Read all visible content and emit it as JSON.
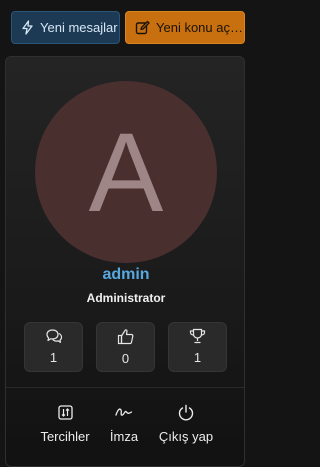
{
  "top_buttons": {
    "new_messages": {
      "label": "Yeni mesajlar",
      "icon": "lightning-icon"
    },
    "new_topic": {
      "label": "Yeni konu aç…",
      "icon": "edit-icon"
    }
  },
  "profile": {
    "avatar_letter": "A",
    "username": "admin",
    "role": "Administrator",
    "stats": [
      {
        "icon": "messages-icon",
        "value": "1"
      },
      {
        "icon": "thumbs-up-icon",
        "value": "0"
      },
      {
        "icon": "trophy-icon",
        "value": "1"
      }
    ],
    "actions": [
      {
        "icon": "preferences-icon",
        "label": "Tercihler"
      },
      {
        "icon": "signature-icon",
        "label": "İmza"
      },
      {
        "icon": "power-icon",
        "label": "Çıkış yap"
      }
    ]
  },
  "colors": {
    "username": "#58a8e0",
    "new_messages_bg": "#1c3a54",
    "new_topic_bg": "#c8700f",
    "avatar_bg": "#4a2f2f"
  }
}
